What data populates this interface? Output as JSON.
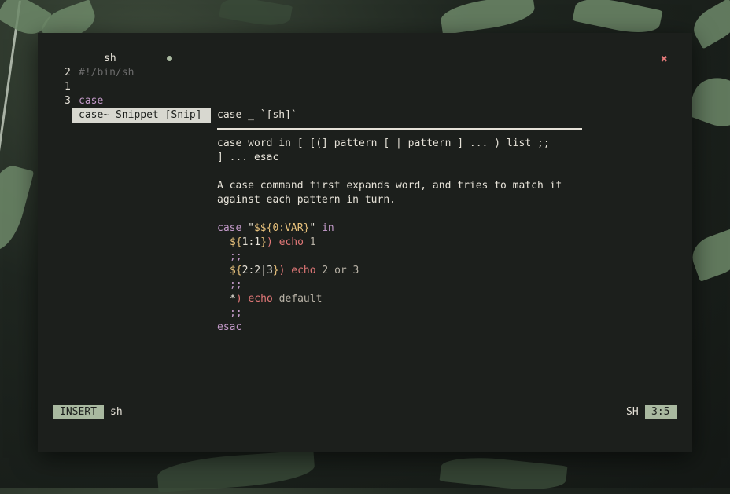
{
  "tab": {
    "title": "sh"
  },
  "editor": {
    "lines": [
      {
        "number": "2",
        "text": "#!/bin/sh"
      },
      {
        "number": "1",
        "text": ""
      },
      {
        "number": "3",
        "text": "case"
      }
    ]
  },
  "completion": {
    "item_label": "case~ Snippet [Snip]"
  },
  "doc": {
    "header": "case _ `[sh]`",
    "syntax_1": "case word in [ [(] pattern [ | pattern ] ... ) list ;;",
    "syntax_2": "] ... esac",
    "desc_1": "A case command first expands word, and tries to match it",
    "desc_2": "against each pattern in turn.",
    "code": {
      "l1_kw": "case",
      "l1_q1": " \"",
      "l1_var": "$${0:VAR}",
      "l1_q2": "\" ",
      "l1_in": "in",
      "l2_a": "${",
      "l2_b": "1:1",
      "l2_c": "}",
      "l2_paren": ")",
      "l2_cmd": " echo",
      "l2_arg": " 1",
      "l3": ";;",
      "l4_a": "${",
      "l4_b": "2:2|3",
      "l4_c": "}",
      "l4_paren": ")",
      "l4_cmd": " echo",
      "l4_arg": " 2 or 3",
      "l5": ";;",
      "l6_star": "*",
      "l6_paren": ")",
      "l6_cmd": " echo",
      "l6_arg": " default",
      "l7": ";;",
      "l8": "esac"
    }
  },
  "statusbar": {
    "mode": "INSERT",
    "filename": "sh",
    "filetype": "SH",
    "position": "3:5"
  },
  "colors": {
    "accent_green": "#a9b9a0",
    "close_red": "#e27878",
    "keyword_purple": "#c39ac9",
    "variable_yellow": "#e6c07b"
  },
  "icons": {
    "close": "close-icon",
    "modified": "modified-dot-icon"
  }
}
